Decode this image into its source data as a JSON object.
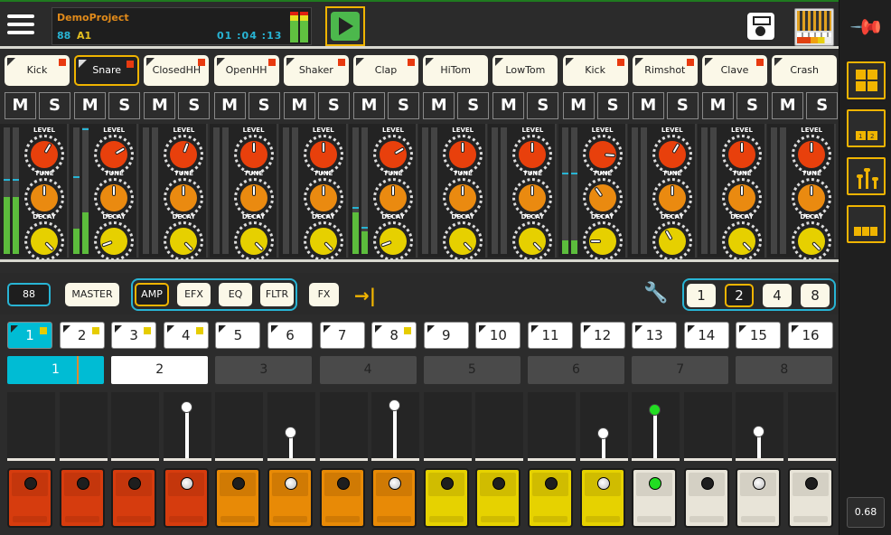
{
  "header": {
    "project_name": "DemoProject",
    "bpm": "88",
    "key": "A1",
    "time": "01 :04 :13",
    "menu_icon": "hamburger-menu-icon",
    "play_icon": "play-icon",
    "save_icon": "floppy-save-icon",
    "kit_icon": "drum-machine-thumbnail-icon"
  },
  "colors": {
    "accent_yellow": "#f0b400",
    "accent_cyan": "#28b4d4",
    "led_red": "#e83a10",
    "knob_level": "#e8400c",
    "knob_tune": "#ea8a10",
    "knob_decay": "#e6d000",
    "active_green": "#22dd22"
  },
  "instruments": [
    {
      "label": "Kick",
      "led": true,
      "selected": false
    },
    {
      "label": "Snare",
      "led": true,
      "selected": true
    },
    {
      "label": "ClosedHH",
      "led": true,
      "selected": false
    },
    {
      "label": "OpenHH",
      "led": true,
      "selected": false
    },
    {
      "label": "Shaker",
      "led": true,
      "selected": false
    },
    {
      "label": "Clap",
      "led": true,
      "selected": false
    },
    {
      "label": "HiTom",
      "led": false,
      "selected": false
    },
    {
      "label": "LowTom",
      "led": false,
      "selected": false
    },
    {
      "label": "Kick",
      "led": true,
      "selected": false
    },
    {
      "label": "Rimshot",
      "led": true,
      "selected": false
    },
    {
      "label": "Clave",
      "led": true,
      "selected": false
    },
    {
      "label": "Crash",
      "led": false,
      "selected": false
    }
  ],
  "mute_label": "M",
  "solo_label": "S",
  "knob_labels": {
    "level": "LEVEL",
    "tune": "TUNE",
    "decay": "DECAY"
  },
  "channels": [
    {
      "meter_l": 0.45,
      "meter_r": 0.45,
      "peak_l": 0.58,
      "peak_r": 0.58,
      "clip": false,
      "level": 30,
      "tune": 0,
      "decay": 135
    },
    {
      "meter_l": 0.2,
      "meter_r": 0.33,
      "peak_l": 0.6,
      "peak_r": 0.98,
      "clip": true,
      "level": 60,
      "tune": 0,
      "decay": -110
    },
    {
      "meter_l": 0,
      "meter_r": 0,
      "peak_l": 0,
      "peak_r": 0,
      "clip": false,
      "level": 20,
      "tune": 0,
      "decay": 135
    },
    {
      "meter_l": 0,
      "meter_r": 0,
      "peak_l": 0,
      "peak_r": 0,
      "clip": false,
      "level": 0,
      "tune": 0,
      "decay": 135
    },
    {
      "meter_l": 0,
      "meter_r": 0,
      "peak_l": 0,
      "peak_r": 0,
      "clip": false,
      "level": 0,
      "tune": 0,
      "decay": 135
    },
    {
      "meter_l": 0.33,
      "meter_r": 0.18,
      "peak_l": 0.36,
      "peak_r": 0.2,
      "clip": true,
      "level": 60,
      "tune": 0,
      "decay": -110
    },
    {
      "meter_l": 0,
      "meter_r": 0,
      "peak_l": 0,
      "peak_r": 0,
      "clip": false,
      "level": 0,
      "tune": 0,
      "decay": 135
    },
    {
      "meter_l": 0,
      "meter_r": 0,
      "peak_l": 0,
      "peak_r": 0,
      "clip": false,
      "level": 0,
      "tune": 0,
      "decay": 135
    },
    {
      "meter_l": 0.11,
      "meter_r": 0.11,
      "peak_l": 0.63,
      "peak_r": 0.63,
      "clip": false,
      "level": 95,
      "tune": -35,
      "decay": -90
    },
    {
      "meter_l": 0,
      "meter_r": 0,
      "peak_l": 0,
      "peak_r": 0,
      "clip": false,
      "level": 30,
      "tune": 0,
      "decay": -30
    },
    {
      "meter_l": 0,
      "meter_r": 0,
      "peak_l": 0,
      "peak_r": 0,
      "clip": false,
      "level": 0,
      "tune": 0,
      "decay": 135
    },
    {
      "meter_l": 0,
      "meter_r": 0,
      "peak_l": 0,
      "peak_r": 0,
      "clip": false,
      "level": 0,
      "tune": 0,
      "decay": 135
    }
  ],
  "controls": {
    "bpm_button": "88",
    "master": "MASTER",
    "amp": "AMP",
    "efx": "EFX",
    "eq": "EQ",
    "fltr": "FLTR",
    "fx": "FX",
    "arrow_icon": "arrow-to-end-icon",
    "wrench_icon": "wrench-icon",
    "zoom_options": [
      "1",
      "2",
      "4",
      "8"
    ],
    "zoom_selected": "2"
  },
  "steps": [
    {
      "label": "1",
      "active": true,
      "led": true
    },
    {
      "label": "2",
      "active": false,
      "led": true
    },
    {
      "label": "3",
      "active": false,
      "led": true
    },
    {
      "label": "4",
      "active": false,
      "led": true
    },
    {
      "label": "5",
      "active": false,
      "led": false
    },
    {
      "label": "6",
      "active": false,
      "led": false
    },
    {
      "label": "7",
      "active": false,
      "led": false
    },
    {
      "label": "8",
      "active": false,
      "led": true
    },
    {
      "label": "9",
      "active": false,
      "led": false
    },
    {
      "label": "10",
      "active": false,
      "led": false
    },
    {
      "label": "11",
      "active": false,
      "led": false
    },
    {
      "label": "12",
      "active": false,
      "led": false
    },
    {
      "label": "13",
      "active": false,
      "led": false
    },
    {
      "label": "14",
      "active": false,
      "led": false
    },
    {
      "label": "15",
      "active": false,
      "led": false
    },
    {
      "label": "16",
      "active": false,
      "led": false
    }
  ],
  "pages": [
    {
      "label": "1",
      "state": "current",
      "playhead": 0.72
    },
    {
      "label": "2",
      "state": "white"
    },
    {
      "label": "3",
      "state": "off"
    },
    {
      "label": "4",
      "state": "off"
    },
    {
      "label": "5",
      "state": "off"
    },
    {
      "label": "6",
      "state": "off"
    },
    {
      "label": "7",
      "state": "off"
    },
    {
      "label": "8",
      "state": "off"
    }
  ],
  "sequencer": [
    {
      "on": false,
      "velocity": 0,
      "color": "red"
    },
    {
      "on": false,
      "velocity": 0,
      "color": "red"
    },
    {
      "on": false,
      "velocity": 0,
      "color": "red"
    },
    {
      "on": true,
      "velocity": 0.85,
      "color": "red"
    },
    {
      "on": false,
      "velocity": 0,
      "color": "orange"
    },
    {
      "on": true,
      "velocity": 0.4,
      "color": "orange"
    },
    {
      "on": false,
      "velocity": 0,
      "color": "orange"
    },
    {
      "on": true,
      "velocity": 0.88,
      "color": "orange"
    },
    {
      "on": false,
      "velocity": 0,
      "color": "yellow"
    },
    {
      "on": false,
      "velocity": 0,
      "color": "yellow"
    },
    {
      "on": false,
      "velocity": 0,
      "color": "yellow"
    },
    {
      "on": true,
      "velocity": 0.38,
      "color": "yellow"
    },
    {
      "on": true,
      "velocity": 0.8,
      "color": "white",
      "playing": true
    },
    {
      "on": false,
      "velocity": 0,
      "color": "white"
    },
    {
      "on": true,
      "velocity": 0.42,
      "color": "white"
    },
    {
      "on": false,
      "velocity": 0,
      "color": "white"
    }
  ],
  "sidebar": {
    "pin_icon": "pin-icon",
    "buttons": [
      "grid-view-icon",
      "pattern-1-2-icon",
      "mixer-faders-icon",
      "step-bars-icon"
    ],
    "cpu_load": "0.68"
  }
}
